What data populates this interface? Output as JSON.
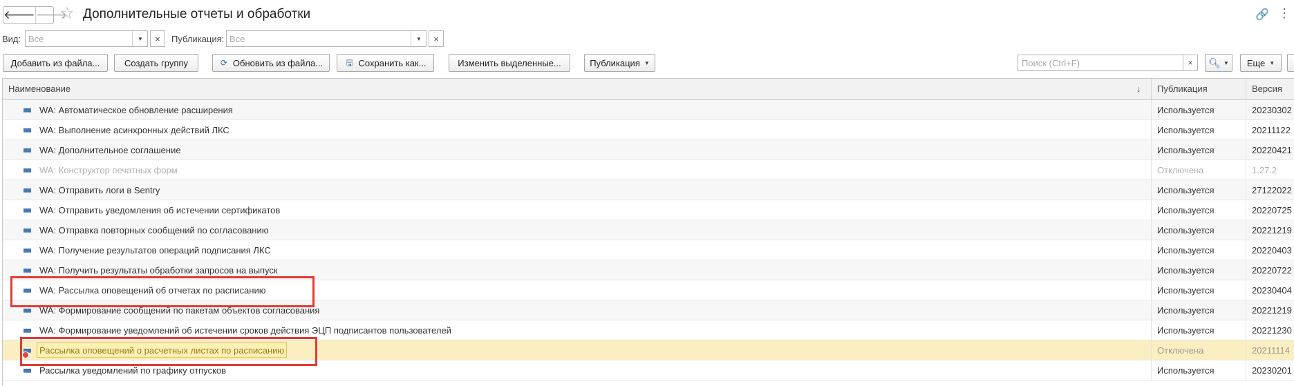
{
  "window": {
    "title": "Дополнительные отчеты и обработки",
    "nav_back_icon": "arrow-left-icon",
    "nav_forward_icon": "arrow-right-icon",
    "favorite_icon": "star-icon",
    "link_icon": "link-icon",
    "more_icon": "vertical-dots-icon"
  },
  "filters": {
    "kind_label": "Вид:",
    "kind_placeholder": "Все",
    "publication_label": "Публикация:",
    "publication_placeholder": "Все",
    "clear_glyph": "×",
    "dropdown_glyph": "▼"
  },
  "toolbar": {
    "add_from_file": "Добавить из файла...",
    "create_group": "Создать группу",
    "update_from_file": "Обновить из файла...",
    "save_as": "Сохранить как...",
    "change_selected": "Изменить выделенные...",
    "publication": "Публикация",
    "search_placeholder": "Поиск (Ctrl+F)",
    "more": "Еще"
  },
  "table": {
    "columns": [
      "Наименование",
      "Публикация",
      "Версия"
    ],
    "sort_indicator": "↓",
    "rows": [
      {
        "name": "WA: Автоматическое обновление расширения",
        "publication": "Используется",
        "version": "20230302"
      },
      {
        "name": "WA: Выполнение асинхронных действий ЛКС",
        "publication": "Используется",
        "version": "20211122"
      },
      {
        "name": "WA: Дополнительное соглашение",
        "publication": "Используется",
        "version": "20220421"
      },
      {
        "name": "WA: Конструктор печатных форм",
        "publication": "Отключена",
        "version": "1.27.2"
      },
      {
        "name": "WA: Отправить логи в Sentry",
        "publication": "Используется",
        "version": "27122022"
      },
      {
        "name": "WA: Отправить уведомления об истечении сертификатов",
        "publication": "Используется",
        "version": "20220725"
      },
      {
        "name": "WA: Отправка повторных сообщений по согласованию",
        "publication": "Используется",
        "version": "20221219"
      },
      {
        "name": "WA: Получение результатов операций подписания ЛКС",
        "publication": "Используется",
        "version": "20220403"
      },
      {
        "name": "WA: Получить результаты обработки запросов на выпуск",
        "publication": "Используется",
        "version": "20220722"
      },
      {
        "name": "WA: Рассылка оповещений об отчетах по расписанию",
        "publication": "Используется",
        "version": "20230404"
      },
      {
        "name": "WA: Формирование сообщений по пакетам объектов согласования",
        "publication": "Используется",
        "version": "20221219"
      },
      {
        "name": "WA: Формирование уведомлений об истечении сроков действия ЭЦП подписантов пользователей",
        "publication": "Используется",
        "version": "20221230"
      },
      {
        "name": "Рассылка оповещений о расчетных листах по расписанию",
        "publication": "Отключена",
        "version": "20211114"
      },
      {
        "name": "Рассылка уведомлений по графику отпусков",
        "publication": "Используется",
        "version": "20230201"
      }
    ]
  }
}
